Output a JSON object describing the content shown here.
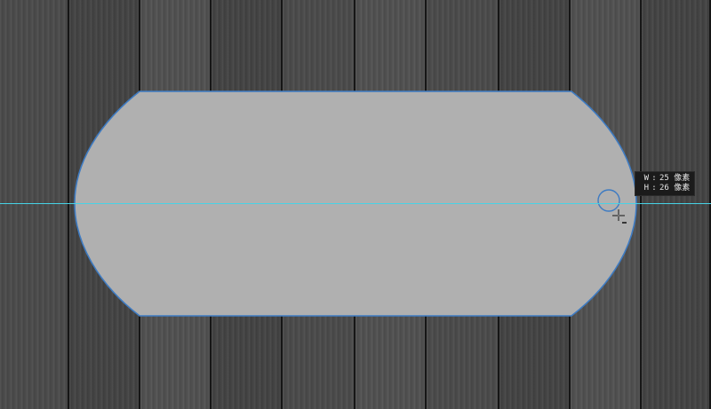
{
  "canvas": {
    "background": "wood-planks",
    "shape_fill": "#b0b0b0",
    "shape_stroke": "#3e7bc2",
    "guide_color": "#46d3e6"
  },
  "tooltip": {
    "w_label": "W",
    "w_value": "25 像素",
    "h_label": "H",
    "h_value": "26 像素",
    "separator": ":"
  },
  "cursor": {
    "icon": "crosshair-minus-icon"
  }
}
